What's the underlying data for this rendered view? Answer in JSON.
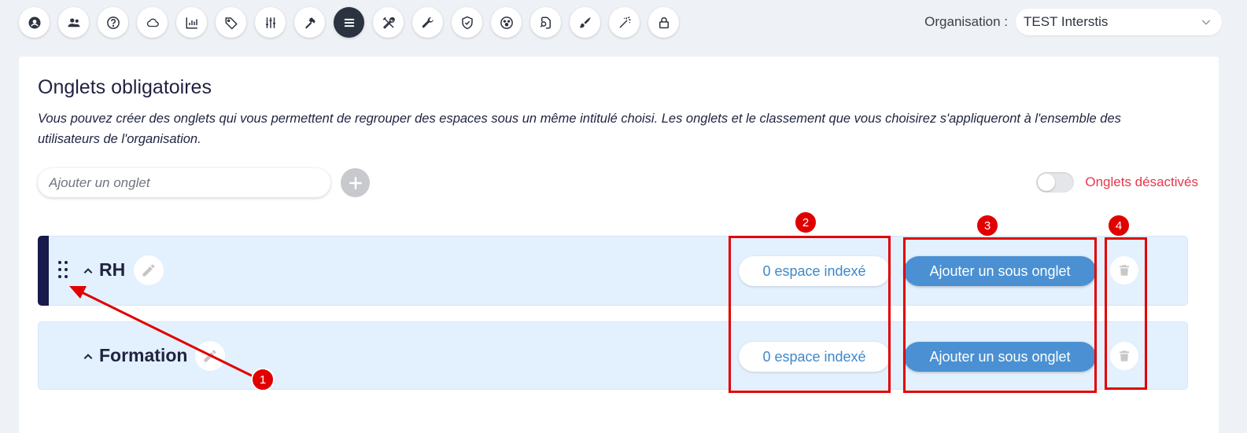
{
  "toolbar": {
    "icons": [
      "user-circle-icon",
      "users-icon",
      "help-icon",
      "cloud-icon",
      "chart-icon",
      "tag-icon",
      "sliders-icon",
      "hammer-icon",
      "list-icon",
      "tools-icon",
      "wrench-icon",
      "shield-check-icon",
      "palette-icon",
      "file-search-icon",
      "brush-icon",
      "magic-wand-icon",
      "lock-icon"
    ],
    "active": "list-icon"
  },
  "organisation": {
    "label": "Organisation :",
    "selected": "TEST Interstis"
  },
  "main": {
    "title": "Onglets obligatoires",
    "description": "Vous pouvez créer des onglets qui vous permettent de regrouper des espaces sous un même intitulé choisi. Les onglets et le classement que vous choisirez s'appliqueront à l'ensemble des utilisateurs de l'organisation.",
    "add_placeholder": "Ajouter un onglet",
    "toggle_label": "Onglets désactivés",
    "toggle_on": false
  },
  "tabs": [
    {
      "name": "RH",
      "indexed": "0 espace indexé",
      "add_sub": "Ajouter un sous onglet"
    },
    {
      "name": "Formation",
      "indexed": "0 espace indexé",
      "add_sub": "Ajouter un sous onglet"
    }
  ],
  "annotations": [
    "1",
    "2",
    "3",
    "4"
  ],
  "colors": {
    "accent": "#4a90d2",
    "annotation": "#e00000",
    "toggle_label": "#e8364a",
    "drag_bar": "#171a4a"
  }
}
